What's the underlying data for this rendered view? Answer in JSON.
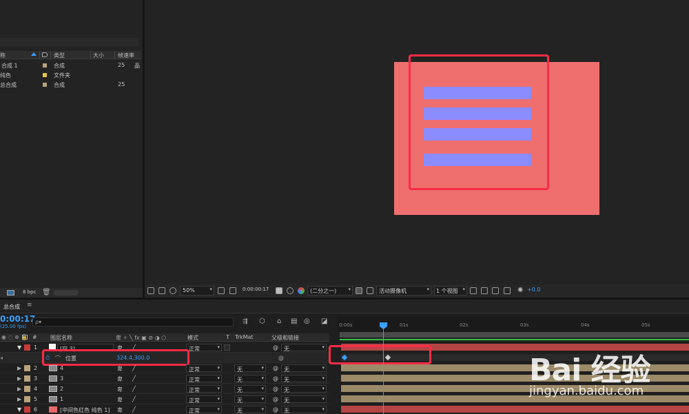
{
  "project": {
    "columns": {
      "name": "称",
      "type": "类型",
      "size": "大小",
      "fps": "帧速率"
    },
    "items": [
      {
        "name": "合成 1",
        "type": "合成",
        "fps": "25",
        "color": "#b9a37b"
      },
      {
        "name": "纯色",
        "type": "文件夹",
        "fps": "",
        "color": "#e5c84a"
      },
      {
        "name": "总合成",
        "type": "合成",
        "fps": "25",
        "color": "#b9a37b"
      }
    ],
    "bpc": "8 bpc"
  },
  "viewer": {
    "zoom": "50%",
    "time": "0:00:00:17",
    "resolution": "(二分之一)",
    "camera": "活动摄像机",
    "views": "1 个视图",
    "exposure": "+0.0"
  },
  "timeline": {
    "tab": "总合成",
    "timecode": "0:00:17",
    "fps": "(25.00 fps)",
    "search_placeholder": "ρ▾",
    "headers": {
      "num": "#",
      "layer_name": "图层名称",
      "mode": "模式",
      "t": "T",
      "trkmat": "TrkMat",
      "parent": "父级和链接"
    },
    "layers": [
      {
        "num": "1",
        "name": "[空 3]",
        "mode": "正常",
        "trkmat": "",
        "parent": "无",
        "color": "#c83a3a"
      },
      {
        "num": "",
        "name": "位置",
        "value": "324.4,300.0",
        "is_property": true
      },
      {
        "num": "2",
        "name": "4",
        "mode": "正常",
        "trkmat": "无",
        "parent": "无",
        "color": "#b9a37b"
      },
      {
        "num": "3",
        "name": "3",
        "mode": "正常",
        "trkmat": "无",
        "parent": "无",
        "color": "#b9a37b"
      },
      {
        "num": "4",
        "name": "2",
        "mode": "正常",
        "trkmat": "无",
        "parent": "无",
        "color": "#b9a37b"
      },
      {
        "num": "5",
        "name": "1",
        "mode": "正常",
        "trkmat": "无",
        "parent": "无",
        "color": "#b9a37b"
      },
      {
        "num": "6",
        "name": "[中间色红色 纯色 1]",
        "mode": "正常",
        "trkmat": "无",
        "parent": "无",
        "color": "#e86a6a"
      }
    ],
    "ruler_ticks": [
      "0:00s",
      "01s",
      "02s",
      "03s",
      "04s",
      "05s"
    ]
  },
  "watermark": {
    "logo": "Bai 经验",
    "url": "jingyan.baidu.com"
  }
}
